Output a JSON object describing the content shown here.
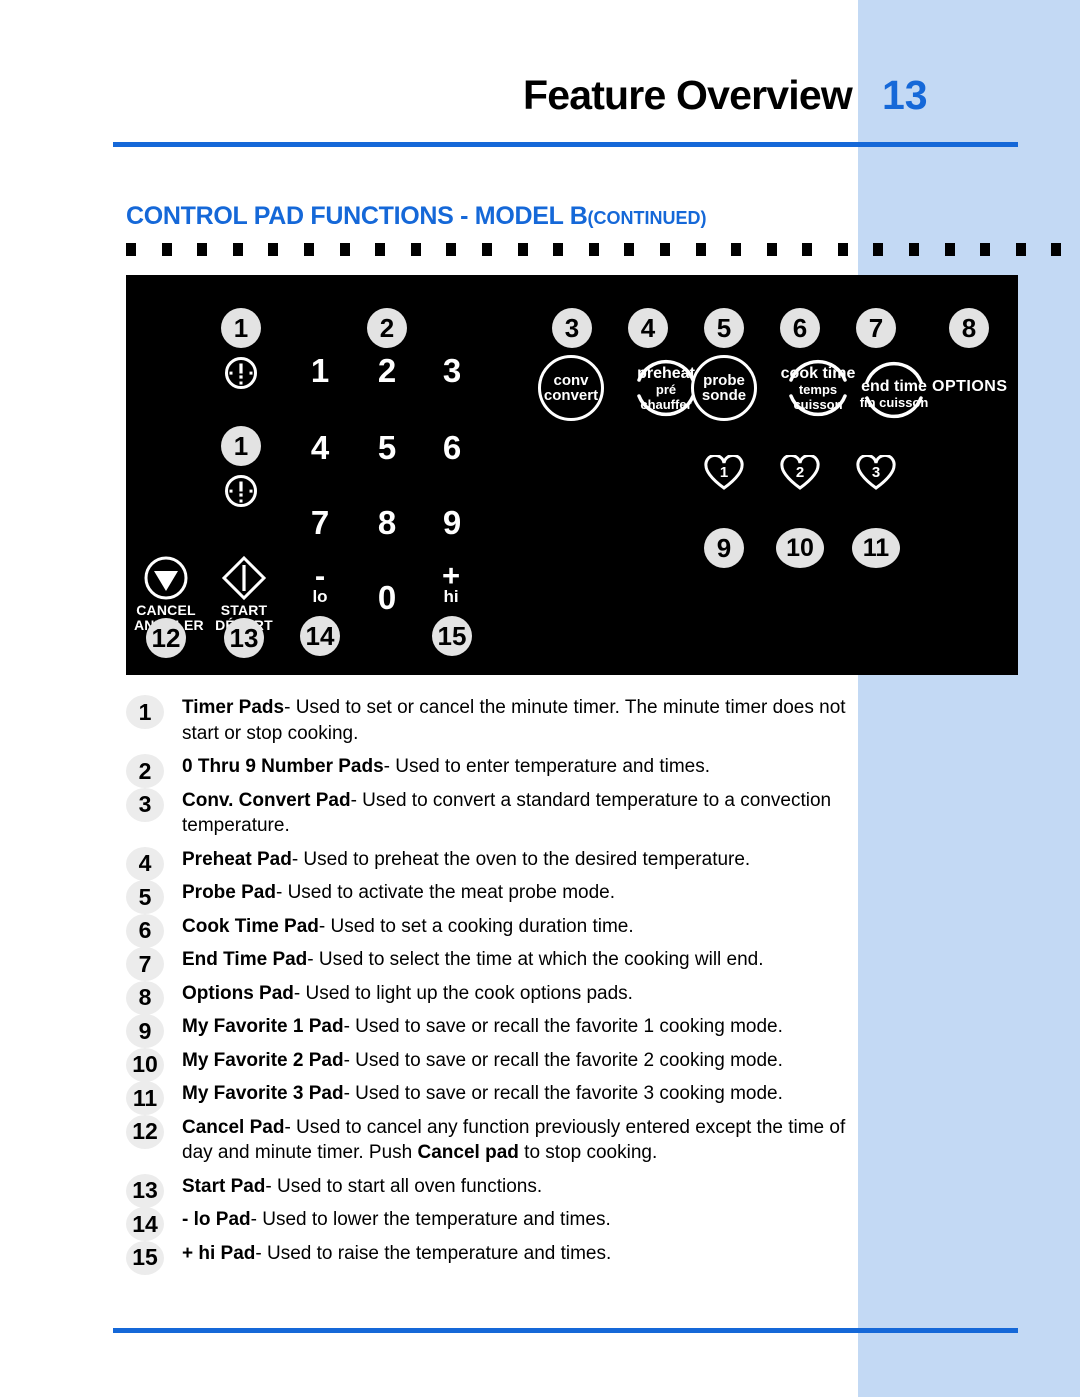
{
  "header": {
    "title": "Feature Overview",
    "page_number": "13"
  },
  "section": {
    "title": "CONTROL PAD FUNCTIONS - MODEL B",
    "continued": "(CONTINUED)"
  },
  "colors": {
    "accent_blue": "#1568d8",
    "band_blue": "#c3d9f4",
    "panel_black": "#000000",
    "badge_gray": "#e3e3e3"
  },
  "panel": {
    "callouts": [
      "1",
      "1",
      "2",
      "3",
      "4",
      "5",
      "6",
      "7",
      "8",
      "9",
      "10",
      "11",
      "12",
      "13",
      "14",
      "15"
    ],
    "timer_pads": [
      {
        "callout": "1",
        "icon": "timer-icon"
      },
      {
        "callout": "1",
        "icon": "timer-icon"
      }
    ],
    "keypad": {
      "callout": "2",
      "digits": [
        "1",
        "2",
        "3",
        "4",
        "5",
        "6",
        "7",
        "8",
        "9",
        "0"
      ],
      "minus": {
        "callout": "14",
        "symbol": "-",
        "word": "lo"
      },
      "plus": {
        "callout": "15",
        "symbol": "+",
        "word": "hi"
      }
    },
    "function_pads": [
      {
        "callout": "3",
        "shape": "circle",
        "line1": "conv",
        "line2": "convert",
        "line3": ""
      },
      {
        "callout": "4",
        "shape": "arc",
        "line1": "preheat",
        "line2": "pré",
        "line3": "chauffer"
      },
      {
        "callout": "5",
        "shape": "circle",
        "line1": "probe",
        "line2": "sonde",
        "line3": ""
      },
      {
        "callout": "6",
        "shape": "arc",
        "line1": "cook time",
        "line2": "temps",
        "line3": "cuisson"
      },
      {
        "callout": "7",
        "shape": "arc",
        "line1": "end time",
        "line2": "fin cuisson",
        "line3": ""
      },
      {
        "callout": "8",
        "shape": "text",
        "line1": "OPTIONS",
        "line2": "",
        "line3": ""
      }
    ],
    "favorites": [
      {
        "callout": "9",
        "number": "1",
        "icon": "heart-icon"
      },
      {
        "callout": "10",
        "number": "2",
        "icon": "heart-icon"
      },
      {
        "callout": "11",
        "number": "3",
        "icon": "heart-icon"
      }
    ],
    "commands": [
      {
        "callout": "12",
        "icon": "cancel-triangle-icon",
        "label_en": "CANCEL",
        "label_fr": "ANNULER"
      },
      {
        "callout": "13",
        "icon": "start-diamond-icon",
        "label_en": "START",
        "label_fr": "DÉPART"
      }
    ]
  },
  "list": [
    {
      "num": "1",
      "term": "Timer Pads",
      "desc": "- Used to set or cancel the minute timer. The minute timer does not start or stop cooking."
    },
    {
      "num": "2",
      "term": "0 Thru 9 Number Pads",
      "desc": "- Used to enter temperature and times."
    },
    {
      "num": "3",
      "term": "Conv. Convert Pad",
      "desc": "- Used to convert a standard temperature to a convection temperature."
    },
    {
      "num": "4",
      "term": "Preheat Pad",
      "desc": "- Used to preheat the oven to the desired temperature."
    },
    {
      "num": "5",
      "term": "Probe Pad",
      "desc": "- Used to activate the meat probe mode."
    },
    {
      "num": "6",
      "term": "Cook Time Pad",
      "desc": "- Used to set a cooking duration time."
    },
    {
      "num": "7",
      "term": "End Time Pad",
      "desc": "- Used to select the time at which the cooking will end."
    },
    {
      "num": "8",
      "term": "Options Pad",
      "desc": "- Used to light up the cook options pads."
    },
    {
      "num": "9",
      "term": "My Favorite 1 Pad",
      "desc": "- Used to save or recall the favorite 1 cooking mode."
    },
    {
      "num": "10",
      "term": "My Favorite 2 Pad",
      "desc": "- Used to save or recall the favorite 2 cooking mode."
    },
    {
      "num": "11",
      "term": "My Favorite 3 Pad",
      "desc": "- Used to save or recall the favorite 3 cooking mode."
    },
    {
      "num": "12",
      "term": "Cancel Pad",
      "desc": "- Used to cancel any function previously entered except the time of day and minute timer. Push ",
      "bold2": "Cancel pad",
      "desc2": " to stop cooking."
    },
    {
      "num": "13",
      "term": "Start Pad",
      "desc": "- Used to start all oven functions."
    },
    {
      "num": "14",
      "term": "- lo Pad",
      "desc": "- Used to lower the temperature and times."
    },
    {
      "num": "15",
      "term": "+ hi Pad",
      "desc": "- Used to raise the temperature and times."
    }
  ]
}
